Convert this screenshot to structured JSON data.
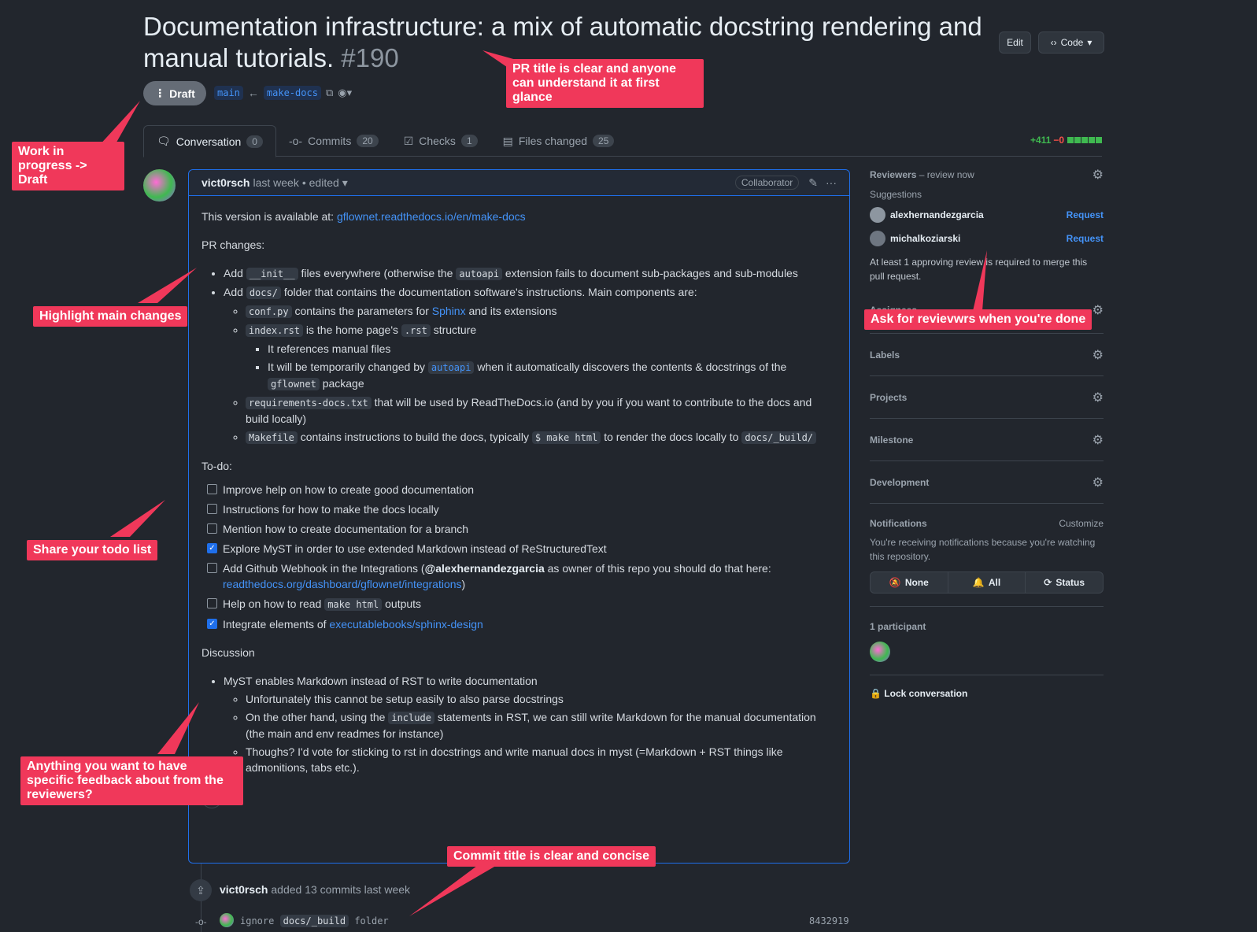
{
  "pr": {
    "title": "Documentation infrastructure: a mix of automatic docstring rendering and manual tutorials.",
    "number": "#190",
    "state": "Draft",
    "base_branch": "main",
    "head_branch": "make-docs",
    "edit_label": "Edit",
    "code_label": "Code"
  },
  "tabs": [
    {
      "label": "Conversation",
      "count": "0"
    },
    {
      "label": "Commits",
      "count": "20"
    },
    {
      "label": "Checks",
      "count": "1"
    },
    {
      "label": "Files changed",
      "count": "25"
    }
  ],
  "diffstat": {
    "additions": "+411",
    "deletions": "−0"
  },
  "comment": {
    "author": "vict0rsch",
    "time": "last week",
    "edited": "• edited",
    "role": "Collaborator",
    "intro": "This version is available at:",
    "intro_link": "gflownet.readthedocs.io/en/make-docs",
    "pr_changes": "PR changes:",
    "add1_pre": "Add",
    "add1_code1": "__init__",
    "add1_mid": "files everywhere (otherwise the",
    "add1_code2": "autoapi",
    "add1_post": "extension fails to document sub-packages and sub-modules",
    "add2_pre": "Add",
    "add2_code": "docs/",
    "add2_post": "folder that contains the documentation software's instructions. Main components are:",
    "conf_code": "conf.py",
    "conf_text": "contains the parameters for",
    "conf_link": "Sphinx",
    "conf_post": "and its extensions",
    "index_code": "index.rst",
    "index_text": "is the home page's",
    "index_code2": ".rst",
    "index_post": "structure",
    "ref_manual": "It references manual files",
    "temp_pre": "It will be temporarily changed by",
    "temp_code": "autoapi",
    "temp_mid": "when it automatically discovers the contents & docstrings of the",
    "temp_code2": "gflownet",
    "temp_post": "package",
    "req_code": "requirements-docs.txt",
    "req_text": "that will be used by ReadTheDocs.io (and by you if you want to contribute to the docs and build locally)",
    "make_code": "Makefile",
    "make_text": "contains instructions to build the docs, typically",
    "make_code2": "$ make html",
    "make_mid": "to render the docs locally to",
    "make_code3": "docs/_build/",
    "todo_heading": "To-do:",
    "todo": [
      {
        "text": "Improve help on how to create good documentation",
        "checked": false
      },
      {
        "text": "Instructions for how to make the docs locally",
        "checked": false
      },
      {
        "text": "Mention how to create documentation for a branch",
        "checked": false
      },
      {
        "text": "Explore MyST in order to use extended Markdown instead of ReStructuredText",
        "checked": true
      }
    ],
    "todo_webhook_pre": "Add Github Webhook in the Integrations (",
    "todo_webhook_mention": "@alexhernandezgarcia",
    "todo_webhook_mid": "as owner of this repo you should do that here:",
    "todo_webhook_link": "readthedocs.org/dashboard/gflownet/integrations",
    "todo_webhook_post": ")",
    "todo_read_pre": "Help on how to read",
    "todo_read_code": "make html",
    "todo_read_post": "outputs",
    "todo_integrate_pre": "Integrate elements of",
    "todo_integrate_link": "executablebooks/sphinx-design",
    "discussion_heading": "Discussion",
    "disc1": "MyST enables Markdown instead of RST to write documentation",
    "disc1a": "Unfortunately this cannot be setup easily to also parse docstrings",
    "disc1b_pre": "On the other hand, using the",
    "disc1b_code": "include",
    "disc1b_post": "statements in RST, we can still write Markdown for the manual documentation (the main and env readmes for instance)",
    "disc1c": "Thoughs? I'd vote for sticking to rst in docstrings and write manual docs in myst (=Markdown + RST things like admonitions, tabs etc.)."
  },
  "timeline": {
    "author": "vict0rsch",
    "event": "added 13 commits last week",
    "commit_pre": "ignore",
    "commit_code": "docs/_build",
    "commit_post": "folder",
    "sha": "8432919"
  },
  "sidebar": {
    "reviewers_title": "Reviewers",
    "reviewers_sub": "– review now",
    "suggestions": "Suggestions",
    "reviewers": [
      {
        "name": "alexhernandezgarcia",
        "action": "Request"
      },
      {
        "name": "michalkoziarski",
        "action": "Request"
      }
    ],
    "approval_note": "At least 1 approving review is required to merge this pull request.",
    "assignees": "Assignees",
    "labels": "Labels",
    "projects": "Projects",
    "milestone": "Milestone",
    "development": "Development",
    "notifications": "Notifications",
    "customize": "Customize",
    "notif_note": "You're receiving notifications because you're watching this repository.",
    "notif_none": "None",
    "notif_all": "All",
    "notif_status": "Status",
    "participants": "1 participant",
    "lock": "Lock conversation"
  },
  "callouts": {
    "title": "PR title is clear and anyone can understand it at first glance",
    "draft": "Work in progress -> Draft",
    "changes": "Highlight main changes",
    "todo": "Share your todo list",
    "feedback": "Anything you want to have specific feedback about from the reviewers?",
    "reviewers": "Ask for revievwrs when you're done",
    "commit": "Commit title is clear and concise"
  },
  "colors": {
    "accent": "#f0385a",
    "link": "#4493f8",
    "add": "#3fb950",
    "del": "#f85149"
  }
}
